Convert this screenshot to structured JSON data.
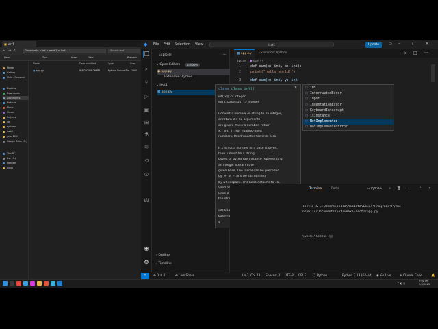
{
  "explorer_window": {
    "tab_title": "lect1",
    "path": "Documents  >  iot  >  week1  >  lect1",
    "search_placeholder": "Search lect1",
    "toolbar": [
      "New",
      "Sort",
      "View",
      "Filter",
      "Preview"
    ],
    "nav_items": [
      "Home",
      "Gallery",
      "Philo - Personal",
      "Desktop",
      "Downloads",
      "Documents",
      "Pictures",
      "Music",
      "Videos",
      "Projects",
      "iot",
      "systems",
      "web1",
      "year 2024",
      "Google Drive (G:)",
      "This PC",
      "Bsc (C:)",
      "Network",
      "Linux"
    ],
    "columns": [
      "Name",
      "Date modified",
      "Type",
      "Size"
    ],
    "files": [
      {
        "name": "app.py",
        "date": "9/4/2025 9:29 PM",
        "type": "Python Source File",
        "size": "1 KB"
      }
    ]
  },
  "vscode": {
    "menu": [
      "File",
      "Edit",
      "Selection",
      "View",
      "..."
    ],
    "command_center": "lect1",
    "update_label": "Update",
    "sidebar": {
      "title": "Explorer",
      "open_editors_label": "Open Editors",
      "unsaved_badge": "1 unsaved",
      "open_editors": [
        "app.py",
        "Extension: Python"
      ],
      "folder": "lect1",
      "files": [
        "app.py"
      ],
      "outline_label": "Outline",
      "timeline_label": "Timeline"
    },
    "tabs": [
      {
        "label": "app.py",
        "active": true
      },
      {
        "label": "Extension: Python",
        "active": false
      }
    ],
    "breadcrumb": [
      "app.py",
      "sum",
      "y"
    ],
    "code_lines": [
      {
        "no": "1",
        "text": "def sum(a: int, b: int):"
      },
      {
        "no": "2",
        "text": "    print(\"hello world!\")"
      },
      {
        "no": "3",
        "text": "def sum(x: int, y: int"
      }
    ],
    "hover": {
      "signature": "class int()",
      "lines": [
        "int([x]) -> integer",
        "int(x, base=10) -> integer",
        "",
        "Convert a number or string to an integer,",
        "or return 0 if no arguments",
        "are given. If x is a number, return",
        "x.__int__(). For floating-point",
        "numbers, this truncates towards zero.",
        "",
        "If x is not a number or if base is given,",
        "then x must be a string,",
        "bytes, or bytearray instance representing",
        "an integer literal in the",
        "given base. The literal can be preceded",
        "by '+' or '-' and be surrounded",
        "by whitespace. The base defaults to 10.",
        "Valid bases are 0 and 2-36.",
        "Base 0 means to interpret the base from",
        "the string as an integer literal.",
        "",
        "    int('0b100',",
        "    base=0)",
        "    4"
      ]
    },
    "suggestions": [
      "int",
      "InterruptedError",
      "input",
      "IndentationError",
      "KeyboardInterrupt",
      "isinstance",
      "NotImplemented",
      "NotImplementedError"
    ],
    "selected_suggestion": 6,
    "panel_tabs": [
      "Terminal",
      "Ports"
    ],
    "terminal_profile": "Python",
    "terminal_lines": [
      "lect1> & C:\\Users\\philo\\AppData\\Local\\Programs\\Pytho",
      "n/philo/Documents/iot/week1/lect1/app.py",
      "",
      "\\week1\\lect1> []"
    ],
    "status": {
      "errors": "0",
      "warnings": "0",
      "live_share": "Live Share",
      "position": "Ln 3, Col 23",
      "spaces": "Spaces: 2",
      "encoding": "UTF-8",
      "eol": "CRLF",
      "language": "Python",
      "interpreter": "Python 3.13 (64-bit)",
      "go_live": "Go Live",
      "claude": "Claude Code"
    }
  },
  "taskbar": {
    "time": "9:00 PM",
    "date": "9/4/2025"
  },
  "colors": {
    "accent": "#0e639c",
    "keyword": "#569cd6",
    "function": "#dcdcaa",
    "type": "#4ec9b0",
    "string": "#ce9178",
    "param": "#9cdcfe",
    "selection": "#04395e"
  }
}
